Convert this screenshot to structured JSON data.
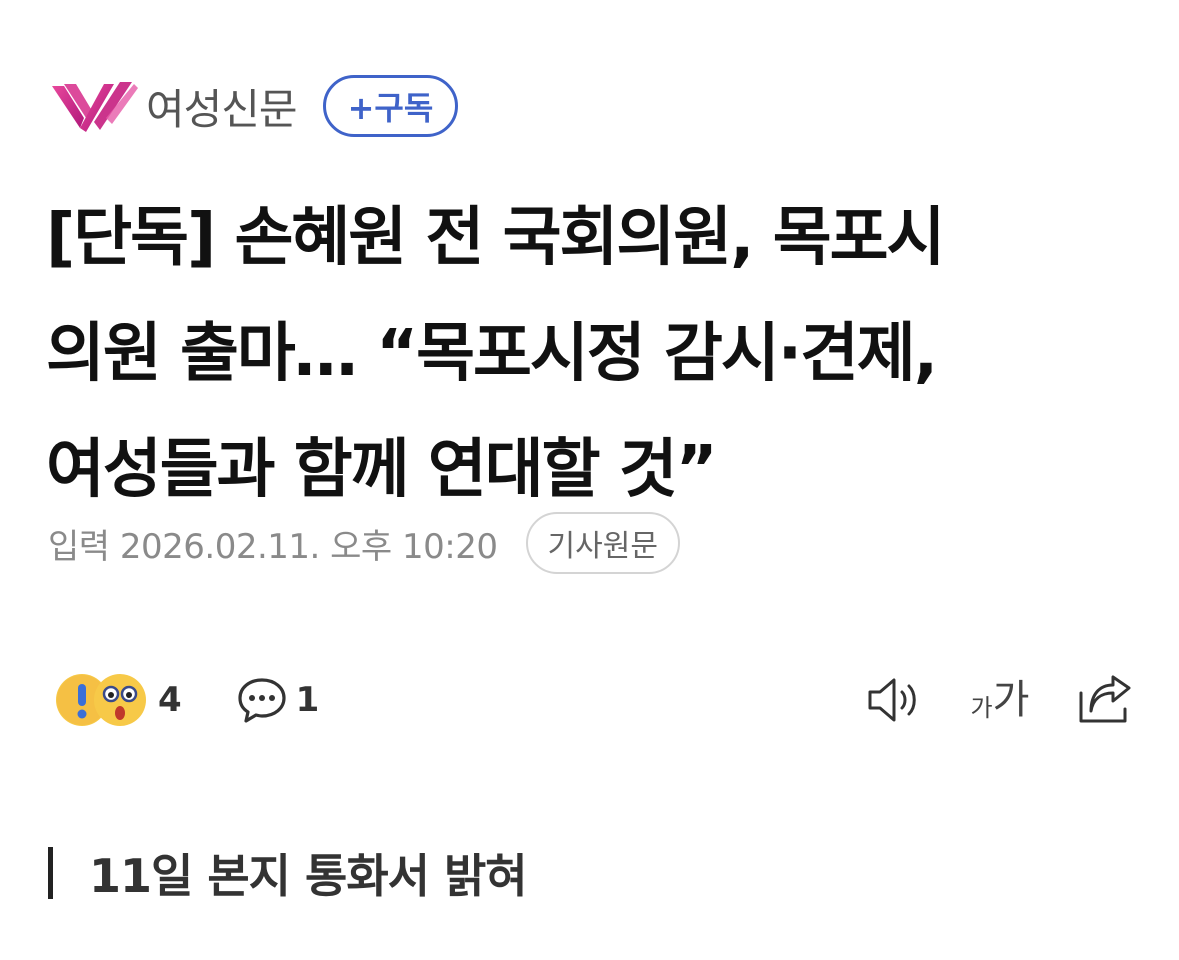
{
  "publisher": {
    "name": "여성신문",
    "logo_icon": "publisher-logo-icon",
    "brand_color": "#d62a8a"
  },
  "subscribe": {
    "label": "+구독",
    "color": "#3f63c9"
  },
  "article": {
    "headline": "[단독] 손혜원 전 국회의원, 목포시\n의원 출마… “목포시정 감시·견제,\n여성들과 함께 연대할 것”",
    "timestamp": "입력 2026.02.11. 오후 10:20",
    "original_link_label": "기사원문",
    "subheading": "11일 본지 통화서 밝혀"
  },
  "engagement": {
    "reaction_icons": [
      "surprised-emoji-icon",
      "shocked-emoji-icon"
    ],
    "reaction_count": "4",
    "comment_icon": "comment-bubble-icon",
    "comment_count": "1"
  },
  "tools": {
    "audio_icon": "speaker-icon",
    "font_size_small": "가",
    "font_size_big": "가",
    "share_icon": "share-icon"
  }
}
